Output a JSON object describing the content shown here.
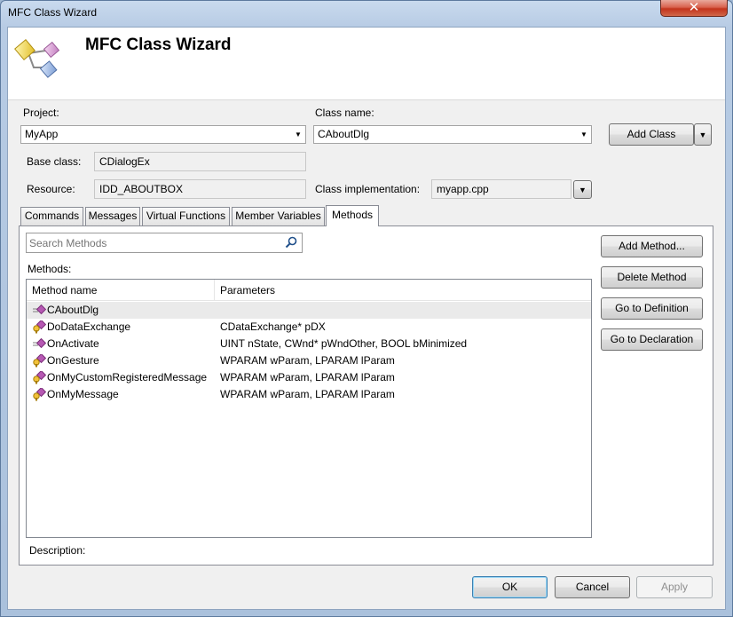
{
  "window": {
    "title": "MFC Class Wizard",
    "close_label": "✕"
  },
  "header": {
    "title": "MFC Class Wizard",
    "icon": "class-wizard-icon"
  },
  "project": {
    "label": "Project:",
    "value": "MyApp"
  },
  "class_name": {
    "label": "Class name:",
    "value": "CAboutDlg"
  },
  "add_class": {
    "label": "Add Class"
  },
  "base_class": {
    "label": "Base class:",
    "value": "CDialogEx"
  },
  "resource": {
    "label": "Resource:",
    "value": "IDD_ABOUTBOX"
  },
  "class_impl": {
    "label": "Class implementation:",
    "value": "myapp.cpp"
  },
  "tabs": [
    {
      "label": "Commands"
    },
    {
      "label": "Messages"
    },
    {
      "label": "Virtual Functions"
    },
    {
      "label": "Member Variables"
    },
    {
      "label": "Methods",
      "active": true
    }
  ],
  "search": {
    "placeholder": "Search Methods"
  },
  "methods": {
    "label": "Methods:",
    "columns": [
      "Method name",
      "Parameters"
    ],
    "rows": [
      {
        "name": "CAboutDlg",
        "params": "",
        "icon": "method-icon",
        "selected": true
      },
      {
        "name": "DoDataExchange",
        "params": "CDataExchange* pDX",
        "icon": "protected-method-icon"
      },
      {
        "name": "OnActivate",
        "params": "UINT nState, CWnd* pWndOther, BOOL bMinimized",
        "icon": "method-icon"
      },
      {
        "name": "OnGesture",
        "params": "WPARAM wParam, LPARAM lParam",
        "icon": "protected-method-icon"
      },
      {
        "name": "OnMyCustomRegisteredMessage",
        "params": "WPARAM wParam, LPARAM lParam",
        "icon": "protected-method-icon"
      },
      {
        "name": "OnMyMessage",
        "params": "WPARAM wParam, LPARAM lParam",
        "icon": "protected-method-icon"
      }
    ]
  },
  "side_buttons": {
    "add_method": "Add Method...",
    "delete_method": "Delete Method",
    "goto_definition": "Go to Definition",
    "goto_declaration": "Go to Declaration"
  },
  "description": {
    "label": "Description:"
  },
  "footer": {
    "ok": "OK",
    "cancel": "Cancel",
    "apply": "Apply"
  }
}
